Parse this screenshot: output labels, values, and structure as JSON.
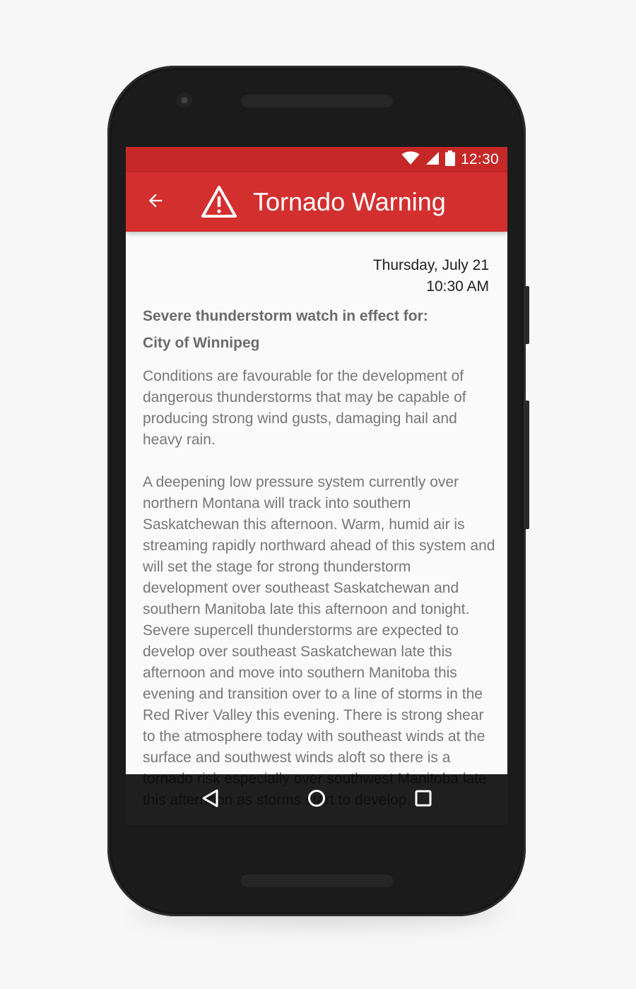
{
  "status_bar": {
    "time": "12:30",
    "icons": [
      "wifi-icon",
      "cell-signal-icon",
      "battery-icon"
    ],
    "color": "#c62828"
  },
  "app_bar": {
    "title": "Tornado Warning",
    "back_icon": "arrow-back-icon",
    "title_icon": "warning-triangle-icon",
    "color": "#d32f2f"
  },
  "alert": {
    "date": "Thursday, July 21",
    "time": "10:30 AM",
    "heading": "Severe thunderstorm watch in effect for:",
    "location": "City of Winnipeg",
    "paragraphs": [
      "Conditions are favourable for the development of dangerous thunderstorms that may be capable of producing strong wind gusts, damaging hail and heavy rain.",
      "A deepening low pressure system currently over northern Montana will track into southern Saskatchewan this afternoon. Warm, humid air is streaming rapidly northward ahead of this system and will set the stage for strong thunderstorm development over southeast Saskatchewan and southern Manitoba late this afternoon and tonight. Severe supercell thunderstorms are expected to develop over southeast Saskatchewan late this afternoon and move into southern Manitoba this evening and transition over to a line of storms in the Red River Valley this evening. There is strong shear to the atmosphere today with southeast winds at the surface and southwest winds aloft so there is a tornado risk especially over southwest Manitoba late this afternoon as storms start to develop."
    ]
  },
  "nav_bar": {
    "buttons": [
      "nav-back-icon",
      "nav-home-icon",
      "nav-recents-icon"
    ]
  }
}
